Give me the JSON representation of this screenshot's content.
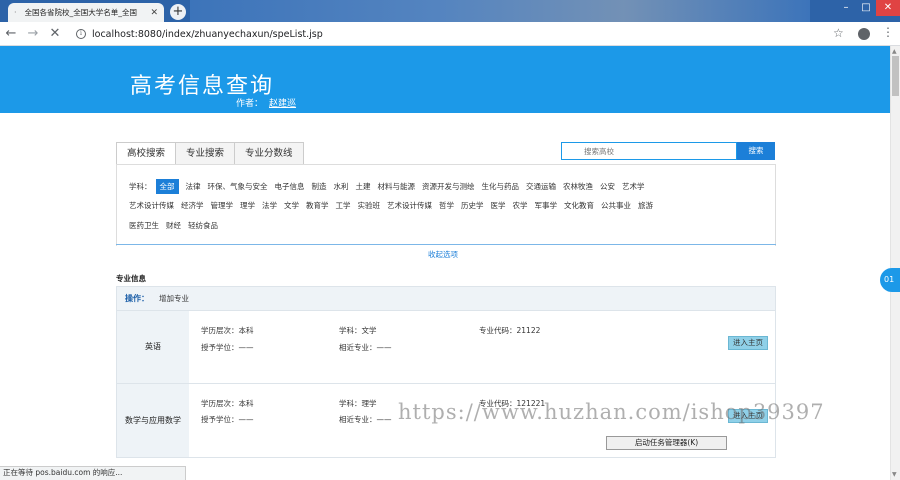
{
  "browser": {
    "tab_title": "全国各省院校_全国大学名单_全国",
    "tab_favicon": "·",
    "tab_close": "✕",
    "new_tab": "+",
    "url": "localhost:8080/index/zhuanyechaxun/speList.jsp",
    "status_text": "正在等待 pos.baidu.com 的响应..."
  },
  "header": {
    "title": "高考信息查询",
    "author_label": "作者：",
    "author_name": "赵建巡"
  },
  "search": {
    "tabs": [
      "高校搜索",
      "专业搜索",
      "专业分数线"
    ],
    "placeholder": "搜索高校",
    "button": "搜索"
  },
  "filter": {
    "label": "学科：",
    "active": "全部",
    "row1": [
      "法律",
      "环保、气象与安全",
      "电子信息",
      "制造",
      "水利",
      "土建",
      "材料与能源",
      "资源开发与测绘",
      "生化与药品",
      "交通运输",
      "农林牧渔",
      "公安",
      "艺术学"
    ],
    "row2": [
      "艺术设计传媒",
      "经济学",
      "管理学",
      "理学",
      "法学",
      "文学",
      "教育学",
      "工学",
      "实验班",
      "艺术设计传媒",
      "哲学",
      "历史学",
      "医学",
      "农学",
      "军事学",
      "文化教育",
      "公共事业",
      "旅游"
    ],
    "row3": [
      "医药卫生",
      "财经",
      "轻纺食品"
    ],
    "collapse": "收起选项"
  },
  "majors": {
    "section_title": "专业信息",
    "ops_label": "操作：",
    "ops_add": "增加专业",
    "rows": [
      {
        "name": "英语",
        "level": "学历层次：本科",
        "degree": "授予学位：——",
        "subject": "学科：文学",
        "similar": "相近专业：——",
        "code": "专业代码：21122",
        "button": "进入主页"
      },
      {
        "name": "数学与应用数学",
        "level": "学历层次：本科",
        "degree": "授予学位：——",
        "subject": "学科：理学",
        "similar": "相近专业：——",
        "code": "专业代码：121221",
        "button": "进入主页"
      }
    ]
  },
  "overlay": {
    "tooltip": "启动任务管理器(K)",
    "watermark": "https://www.huzhan.com/ishop39397",
    "side_float": "01"
  },
  "icons": {
    "back": "back-arrow-icon",
    "forward": "forward-arrow-icon",
    "stop": "stop-icon",
    "info": "info-icon",
    "star": "star-icon",
    "account": "account-icon",
    "menu": "menu-icon"
  },
  "colors": {
    "header_bg": "#1c99e8",
    "accent": "#1c7fd8",
    "enter_button": "#8fd0e8"
  }
}
